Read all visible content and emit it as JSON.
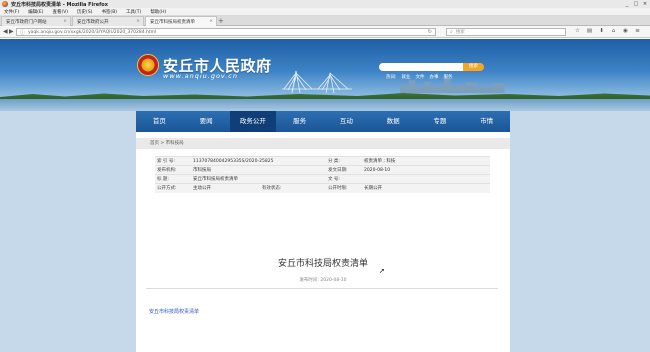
{
  "browser": {
    "window_title": "安丘市科技局权责清单 - Mozilla Firefox",
    "window_buttons": [
      "_",
      "□",
      "×"
    ],
    "menu": [
      "文件(F)",
      "编辑(E)",
      "查看(V)",
      "历史(S)",
      "书签(B)",
      "工具(T)",
      "帮助(H)"
    ],
    "tabs": [
      {
        "label": "安丘市政府门户网站"
      },
      {
        "label": "安丘市政府公开"
      },
      {
        "label": "安丘市科技局权责清单"
      }
    ],
    "new_tab": "+",
    "url": "yaqk.anqiu.gov.cn/xxgk/2020/3/YAQIU2020_370284.html",
    "search_placeholder": "搜索",
    "nav_icons": [
      "back-arrow-icon",
      "forward-arrow-icon"
    ],
    "toolbar_icons": [
      "star",
      "bookmark",
      "download",
      "home",
      "pocket",
      "menu"
    ]
  },
  "site": {
    "title": "安丘市人民政府",
    "url_text": "www.anqiu.gov.cn",
    "search_button": "搜索",
    "hotwords": [
      "热词:",
      "就业",
      "文件",
      "办事",
      "服务"
    ],
    "nav": [
      "首页",
      "要闻",
      "政务公开",
      "服务",
      "互动",
      "数据",
      "专题",
      "市情"
    ],
    "nav_active_index": 2
  },
  "content": {
    "breadcrumb": "首页 > 市科技局",
    "meta": {
      "index_label": "索 引 号:",
      "index_value": "11370784004295335S/2020-25825",
      "category_label": "分    类:",
      "category_value": "权责清单 ; 科技",
      "issuer_label": "发布机构:",
      "issuer_value": "市科技局",
      "date_label": "发文日期:",
      "date_value": "2020-08-10",
      "title_label": "标    题:",
      "title_value": "安丘市科技局权责清单",
      "docno_label": "文    号:",
      "docno_value": "",
      "mode_label": "公开方式:",
      "mode_value": "主动公开",
      "validity_label": "有效状态:",
      "validity_value": "",
      "term_label": "公开时限:",
      "term_value": "长期公开"
    },
    "doc_title": "安丘市科技局权责清单",
    "doc_date": "发布时间: 2020-08-10",
    "attachment_link": "安丘市科技局权责清单"
  }
}
